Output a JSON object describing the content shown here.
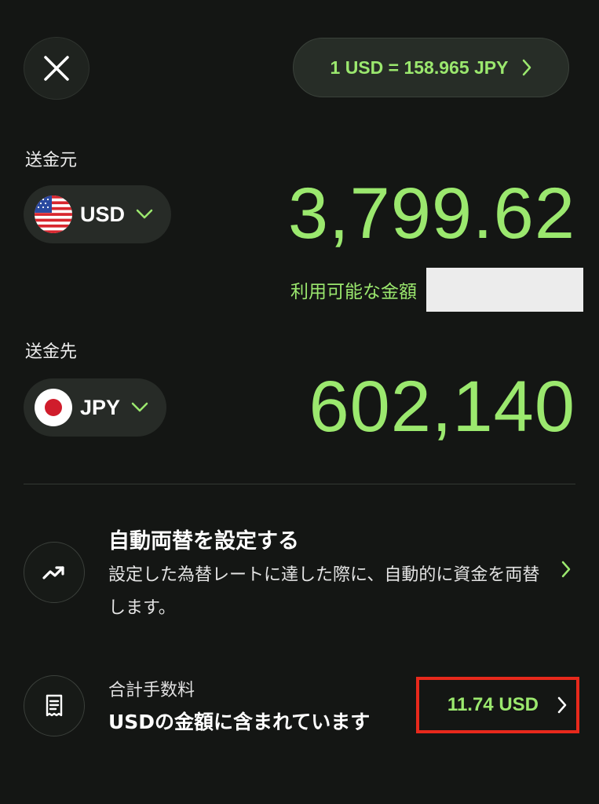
{
  "header": {
    "rate_text": "1 USD = 158.965 JPY"
  },
  "source": {
    "label": "送金元",
    "currency": "USD",
    "amount": "3,799.62",
    "available_label": "利用可能な金額"
  },
  "target": {
    "label": "送金先",
    "currency": "JPY",
    "amount": "602,140"
  },
  "auto_exchange": {
    "title": "自動両替を設定する",
    "description": "設定した為替レートに達した際に、自動的に資金を両替します。"
  },
  "fee": {
    "label": "合計手数料",
    "note": "USDの金額に含まれています",
    "amount": "11.74 USD"
  },
  "colors": {
    "accent": "#9be86e",
    "background": "#141614",
    "highlight": "#e8291c"
  },
  "icons": {
    "close": "close-icon",
    "rate_chevron": "chevron-right-icon",
    "currency_chevron": "chevron-down-icon",
    "auto_exchange": "trend-up-icon",
    "fee": "receipt-icon"
  }
}
